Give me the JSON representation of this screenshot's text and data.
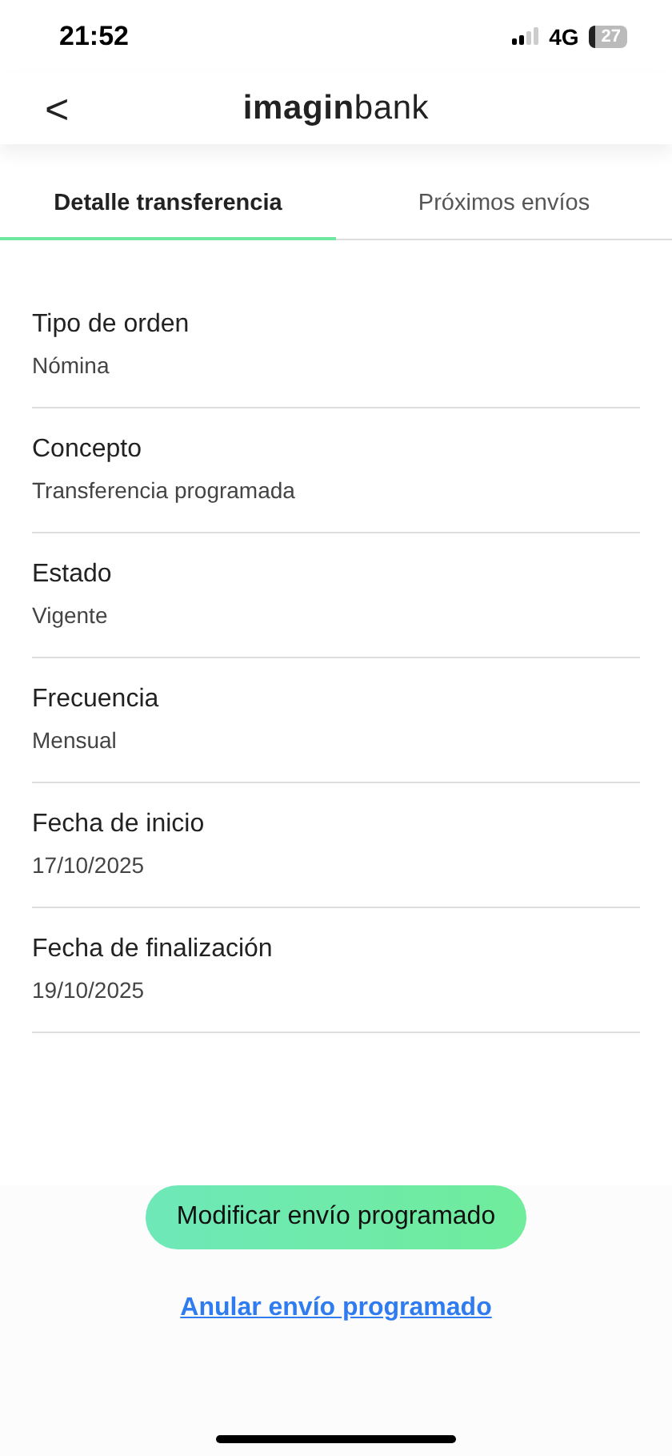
{
  "status_bar": {
    "time": "21:52",
    "network": "4G",
    "battery": "27"
  },
  "header": {
    "back": "<",
    "logo": "**imagin**bank"
  },
  "tabs": [
    {
      "label": "Detalle transferencia",
      "selected": true
    },
    {
      "label": "Próximos envíos",
      "selected": false
    }
  ],
  "details": [
    {
      "label": "Tipo de orden",
      "value": "Nómina"
    },
    {
      "label": "Concepto",
      "value": "Transferencia programada"
    },
    {
      "label": "Estado",
      "value": "Vigente"
    },
    {
      "label": "Frecuencia",
      "value": "Mensual"
    },
    {
      "label": "Fecha de inicio",
      "value": "17/10/2025"
    },
    {
      "label": "Fecha de finalización",
      "value": "19/10/2025"
    }
  ],
  "primary_button": "Modificar envío programado",
  "link": "Anular envío programado"
}
